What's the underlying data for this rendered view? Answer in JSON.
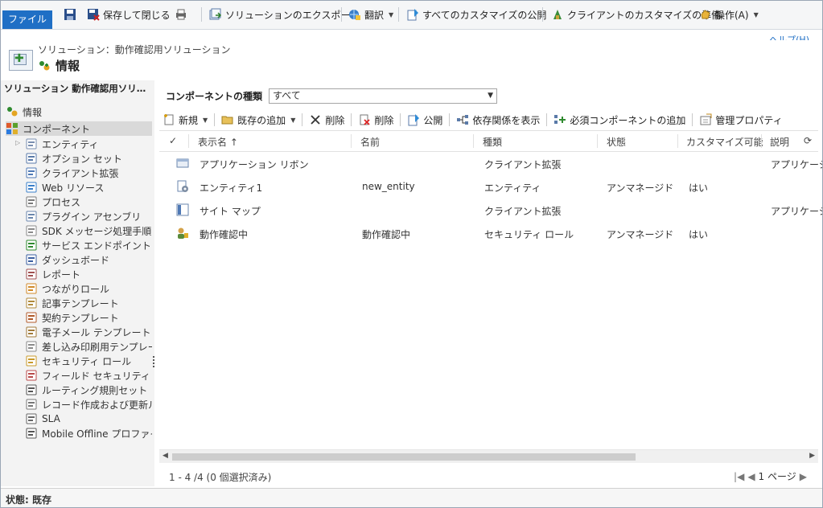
{
  "ribbon": {
    "file_label": "ファイル",
    "save_and_close": "保存して閉じる",
    "export_solution": "ソリューションのエクスポート",
    "translate": "翻訳",
    "publish_all": "すべてのカスタマイズの公開",
    "prepare_client": "クライアントのカスタマイズの準備",
    "actions": "操作(A)",
    "help": "ヘルプ(H)"
  },
  "header": {
    "breadcrumb": "ソリューション：動作確認用ソリューション",
    "title": "情報"
  },
  "leftnav": {
    "heading": "ソリューション 動作確認用ソリュー…",
    "info": "情報",
    "components": "コンポーネント",
    "items": [
      {
        "label": "エンティティ",
        "icon": "entity-icon"
      },
      {
        "label": "オプション セット",
        "icon": "optionset-icon"
      },
      {
        "label": "クライアント拡張",
        "icon": "client-extension-icon"
      },
      {
        "label": "Web リソース",
        "icon": "web-resource-icon"
      },
      {
        "label": "プロセス",
        "icon": "process-icon"
      },
      {
        "label": "プラグイン アセンブリ",
        "icon": "plugin-icon"
      },
      {
        "label": "SDK メッセージ処理手順",
        "icon": "sdk-step-icon"
      },
      {
        "label": "サービス エンドポイント",
        "icon": "service-endpoint-icon"
      },
      {
        "label": "ダッシュボード",
        "icon": "dashboard-icon"
      },
      {
        "label": "レポート",
        "icon": "report-icon"
      },
      {
        "label": "つながりロール",
        "icon": "connection-role-icon"
      },
      {
        "label": "記事テンプレート",
        "icon": "article-template-icon"
      },
      {
        "label": "契約テンプレート",
        "icon": "contract-template-icon"
      },
      {
        "label": "電子メール テンプレート",
        "icon": "email-template-icon"
      },
      {
        "label": "差し込み印刷用テンプレート",
        "icon": "mail-merge-icon"
      },
      {
        "label": "セキュリティ ロール",
        "icon": "security-role-icon"
      },
      {
        "label": "フィールド セキュリティ プロ…",
        "icon": "field-security-icon"
      },
      {
        "label": "ルーティング規則セット",
        "icon": "routing-rule-icon"
      },
      {
        "label": "レコード作成および更新ル…",
        "icon": "record-rule-icon"
      },
      {
        "label": "SLA",
        "icon": "sla-icon"
      },
      {
        "label": "Mobile Offline プロファイル",
        "icon": "mobile-offline-icon"
      }
    ]
  },
  "main": {
    "component_type_label": "コンポーネントの種類",
    "component_type_value": "すべて",
    "toolbar": {
      "new": "新規",
      "add_existing": "既存の追加",
      "remove": "削除",
      "delete": "削除",
      "publish": "公開",
      "show_dependencies": "依存関係を表示",
      "add_required": "必須コンポーネントの追加",
      "managed_properties": "管理プロパティ"
    },
    "columns": {
      "display_name": "表示名 ↑",
      "name": "名前",
      "type": "種類",
      "state": "状態",
      "customizable": "カスタマイズ可能",
      "description": "説明"
    },
    "rows": [
      {
        "display_name": "アプリケーション リボン",
        "name": "",
        "type": "クライアント拡張",
        "state": "",
        "customizable": "",
        "description": "アプリケーシ"
      },
      {
        "display_name": "エンティティ1",
        "name": "new_entity",
        "type": "エンティティ",
        "state": "アンマネージド",
        "customizable": "はい",
        "description": ""
      },
      {
        "display_name": "サイト マップ",
        "name": "",
        "type": "クライアント拡張",
        "state": "",
        "customizable": "",
        "description": "アプリケーシ"
      },
      {
        "display_name": "動作確認中",
        "name": "動作確認中",
        "type": "セキュリティ ロール",
        "state": "アンマネージド",
        "customizable": "はい",
        "description": ""
      }
    ],
    "record_count": "1 - 4 /4 (0 個選択済み)",
    "page": "1 ページ"
  },
  "status": "状態: 既存"
}
